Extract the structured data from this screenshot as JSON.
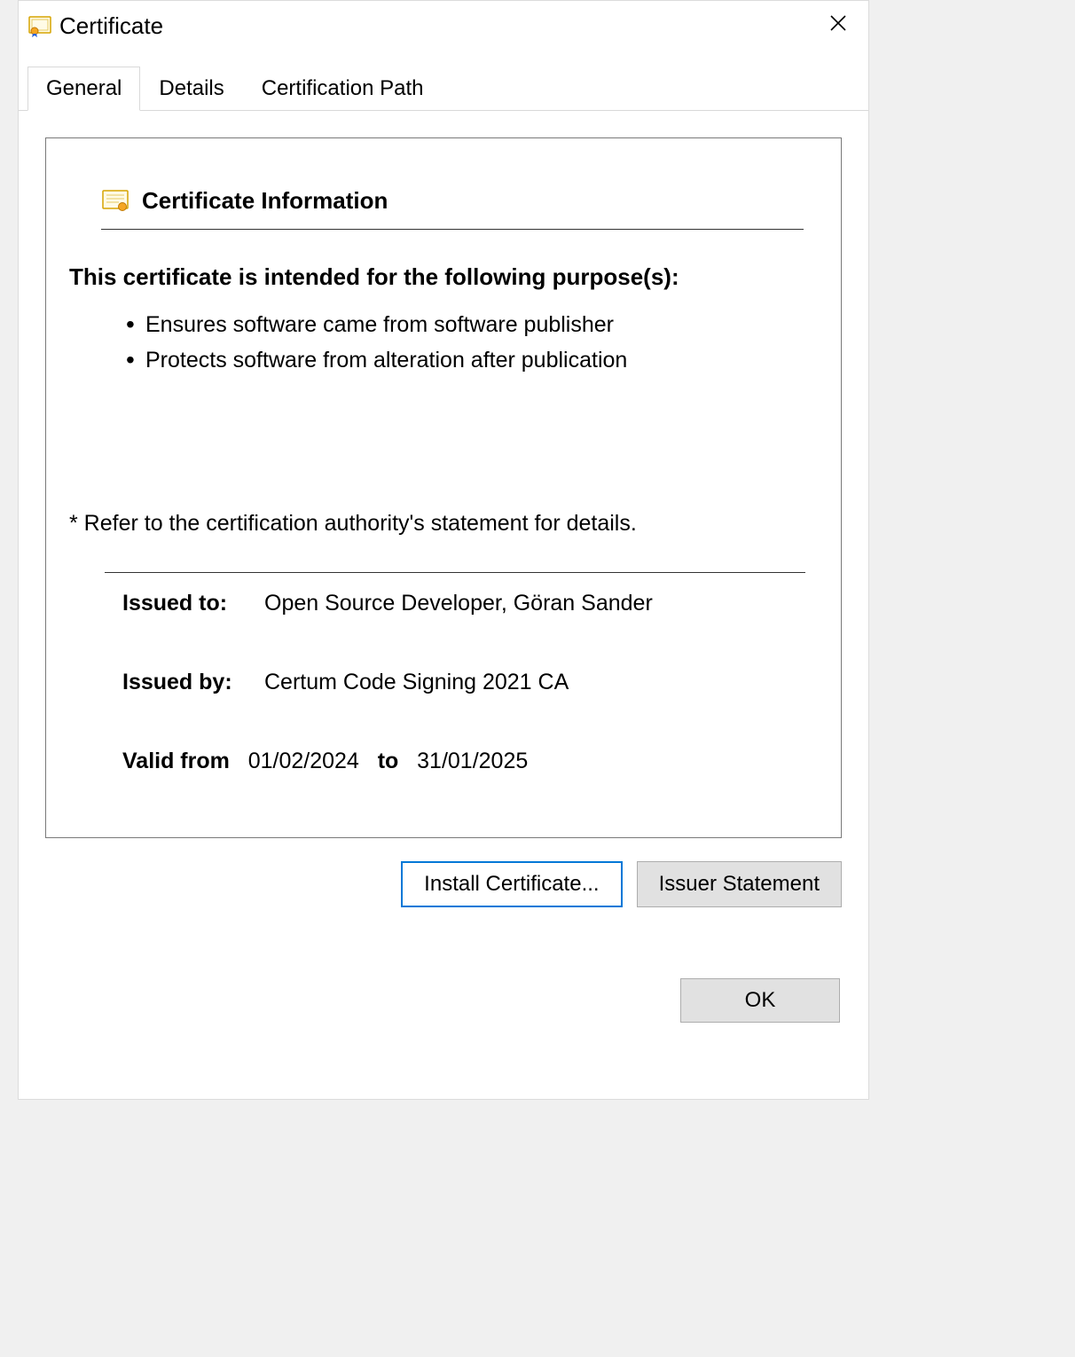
{
  "window": {
    "title": "Certificate"
  },
  "tabs": {
    "general": "General",
    "details": "Details",
    "certpath": "Certification Path"
  },
  "info": {
    "heading": "Certificate Information",
    "purposes_heading": "This certificate is intended for the following purpose(s):",
    "purposes": [
      "Ensures software came from software publisher",
      "Protects software from alteration after publication"
    ],
    "footnote": "* Refer to the certification authority's statement for details.",
    "issued_to_label": "Issued to:",
    "issued_to_value": "Open Source Developer, Göran Sander",
    "issued_by_label": "Issued by:",
    "issued_by_value": "Certum Code Signing 2021 CA",
    "valid_from_label": "Valid from",
    "valid_from_value": "01/02/2024",
    "valid_to_label": "to",
    "valid_to_value": "31/01/2025"
  },
  "buttons": {
    "install": "Install Certificate...",
    "issuer_statement": "Issuer Statement",
    "ok": "OK"
  }
}
